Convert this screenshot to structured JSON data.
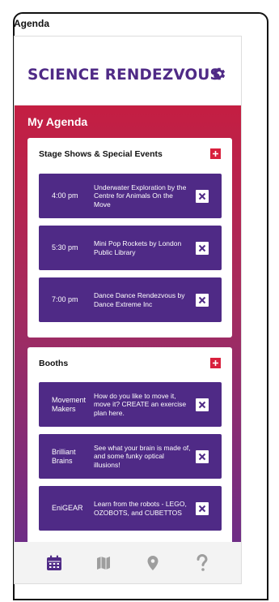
{
  "window": {
    "title": "Agenda"
  },
  "header": {
    "brand": "SCIENCE RENDEZVOUS",
    "settings_icon": "gear-icon"
  },
  "page": {
    "heading": "My Agenda"
  },
  "colors": {
    "brand_purple": "#4f2a86",
    "accent_red": "#d8203d",
    "gradient_top": "#c41e42",
    "gradient_bottom": "#6e2d86"
  },
  "sections": [
    {
      "title": "Stage Shows & Special Events",
      "items": [
        {
          "time": "4:00 pm",
          "name": "Underwater Exploration by the Centre for Animals On the Move"
        },
        {
          "time": "5:30 pm",
          "name": "Mini Pop Rockets by London Public Library"
        },
        {
          "time": "7:00 pm",
          "name": "Dance Dance Rendezvous by Dance Extreme Inc"
        }
      ]
    },
    {
      "title": "Booths",
      "items": [
        {
          "time": "Movement Makers",
          "name": "How do you like to move it, move it? CREATE an exercise plan here."
        },
        {
          "time": "Brilliant Brains",
          "name": "See what your brain is made of, and some funky optical illusions!"
        },
        {
          "time": "EniGEAR",
          "name": "Learn from the robots - LEGO, OZOBOTS, and CUBETTOS"
        }
      ]
    }
  ],
  "tabs": [
    {
      "icon": "calendar-icon",
      "active": true
    },
    {
      "icon": "map-icon",
      "active": false
    },
    {
      "icon": "location-pin-icon",
      "active": false
    },
    {
      "icon": "help-icon",
      "active": false
    }
  ]
}
